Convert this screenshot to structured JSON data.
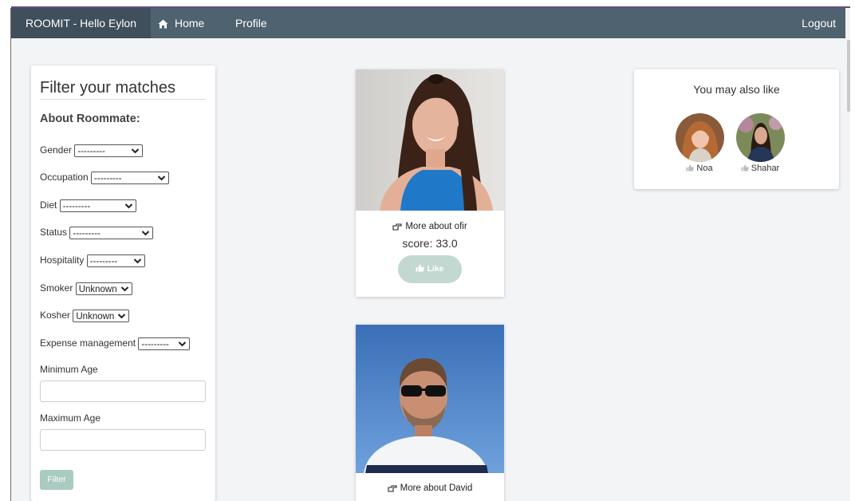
{
  "navbar": {
    "brand": "ROOMIT - Hello Eylon",
    "home": "Home",
    "profile": "Profile",
    "logout": "Logout"
  },
  "filter": {
    "title": "Filter your matches",
    "section_title": "About Roommate:",
    "fields": {
      "gender": {
        "label": "Gender",
        "value": "---------"
      },
      "occupation": {
        "label": "Occupation",
        "value": "---------"
      },
      "diet": {
        "label": "Diet",
        "value": "---------"
      },
      "status": {
        "label": "Status",
        "value": "---------"
      },
      "hospitality": {
        "label": "Hospitality",
        "value": "---------"
      },
      "smoker": {
        "label": "Smoker",
        "value": "Unknown"
      },
      "kosher": {
        "label": "Kosher",
        "value": "Unknown"
      },
      "expense": {
        "label": "Expense management",
        "value": "---------"
      }
    },
    "min_age_label": "Minimum Age",
    "min_age_value": "",
    "max_age_label": "Maximum Age",
    "max_age_value": "",
    "submit_label": "Filter"
  },
  "matches": [
    {
      "more_label": "More about ofir",
      "score_label": "score: 33.0",
      "like_label": "Like"
    },
    {
      "more_label": "More about David"
    }
  ],
  "suggestions": {
    "title": "You may also like",
    "people": [
      {
        "name": "Noa"
      },
      {
        "name": "Shahar"
      }
    ]
  },
  "colors": {
    "navbar": "#4f6270",
    "brand_bg": "#3f4f5c",
    "page_bg": "#f3f4f6",
    "accent_muted": "#c2d8d0",
    "filter_button": "#a9cbc1"
  },
  "icons": {
    "home": "home-icon",
    "hand_pointing": "hand-point-right-icon",
    "thumbs_up": "thumbs-up-icon",
    "chevron": "chevron-down-icon"
  }
}
